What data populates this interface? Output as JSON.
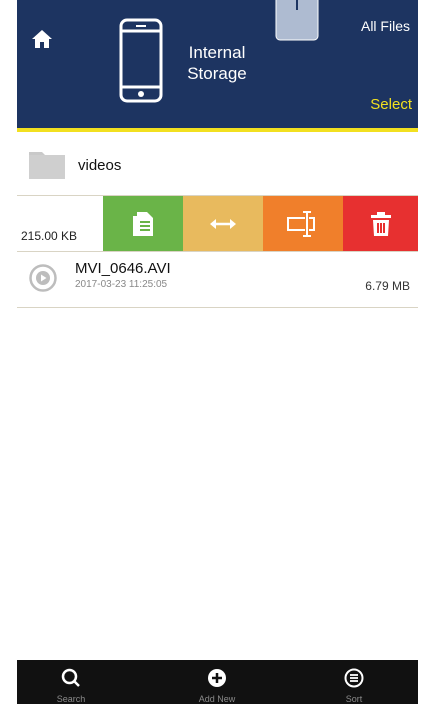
{
  "header": {
    "title_line1": "Internal",
    "title_line2": "Storage",
    "all_files_label": "All Files",
    "select_label": "Select",
    "background_color": "#1d3461",
    "accent_color": "#f2e020"
  },
  "list": {
    "folder": {
      "name": "videos",
      "icon": "folder-icon"
    },
    "swiped_item": {
      "size": "215.00 KB",
      "actions": [
        {
          "name": "copy",
          "icon": "document-copy-icon",
          "color": "#6ab448"
        },
        {
          "name": "move",
          "icon": "swap-arrows-icon",
          "color": "#e8ba5e"
        },
        {
          "name": "rename",
          "icon": "rename-cursor-icon",
          "color": "#f07f2b"
        },
        {
          "name": "delete",
          "icon": "trash-icon",
          "color": "#e73030"
        }
      ]
    },
    "file": {
      "name": "MVI_0646.AVI",
      "date": "2017-03-23 11:25:05",
      "size": "6.79 MB",
      "icon": "play-icon"
    }
  },
  "tabbar": {
    "search_label": "Search",
    "add_label": "Add New",
    "sort_label": "Sort"
  }
}
